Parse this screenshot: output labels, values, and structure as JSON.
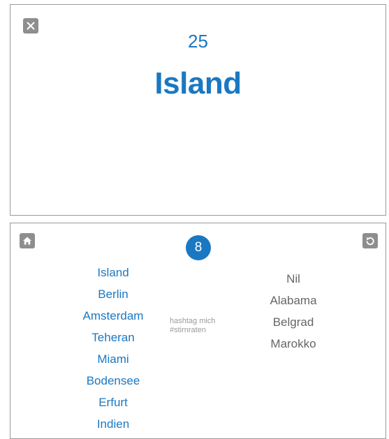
{
  "game": {
    "timer": "25",
    "current_word": "Island"
  },
  "results": {
    "score": "8",
    "correct": [
      "Island",
      "Berlin",
      "Amsterdam",
      "Teheran",
      "Miami",
      "Bodensee",
      "Erfurt",
      "Indien"
    ],
    "passed": [
      "Nil",
      "Alabama",
      "Belgrad",
      "Marokko"
    ],
    "hashtag_line1": "hashtag mich",
    "hashtag_line2": "#stirnraten"
  },
  "icons": {
    "close": "close-icon",
    "home": "home-icon",
    "undo": "undo-icon"
  },
  "colors": {
    "accent": "#1a78c2",
    "button_gray": "#8e8e8e",
    "passed_text": "#666666"
  }
}
